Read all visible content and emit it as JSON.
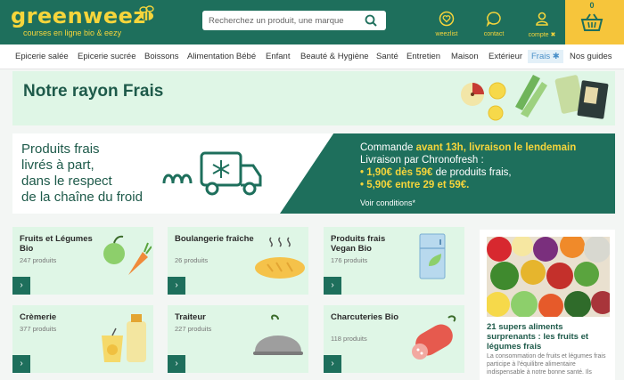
{
  "header": {
    "logo_text": "greenweez",
    "tagline": "courses en ligne bio & eezy",
    "search_placeholder": "Recherchez un produit, une marque",
    "weezlist_label": "weezlist",
    "contact_label": "contact",
    "account_label": "compte ✖",
    "cart_count": "0",
    "colors": {
      "brand_green": "#1e6f5c",
      "brand_yellow": "#f6d53b"
    }
  },
  "nav": {
    "items": [
      {
        "label": "Epicerie salée"
      },
      {
        "label": "Epicerie sucrée"
      },
      {
        "label": "Boissons"
      },
      {
        "label": "Alimentation Bébé"
      },
      {
        "label": "Enfant"
      },
      {
        "label": "Beauté & Hygiène"
      },
      {
        "label": "Santé"
      },
      {
        "label": "Entretien"
      },
      {
        "label": "Maison"
      },
      {
        "label": "Extérieur"
      },
      {
        "label": "Frais ✱"
      },
      {
        "label": "Nos guides"
      }
    ],
    "active": "Frais"
  },
  "banner": {
    "title": "Notre rayon Frais"
  },
  "delivery": {
    "left_line1": "Produits frais",
    "left_line2": "livrés à part,",
    "left_line3": "dans le respect",
    "left_line4": "de la chaîne du froid",
    "commande_prefix": "Commande ",
    "commande_highlight": "avant 13h, livraison le lendemain",
    "chronofresh": "Livraison par Chronofresh :",
    "price1_hl": "• 1,90€ dès 59€",
    "price1_rest": " de produits frais,",
    "price2_hl": "• 5,90€ entre 29 et 59€.",
    "conditions": "Voir conditions*"
  },
  "categories": [
    {
      "title": "Fruits et Légumes Bio",
      "count": "247 produits",
      "icon": "fruits-vegetables-icon"
    },
    {
      "title": "Boulangerie fraîche",
      "count": "26 produits",
      "icon": "bread-icon"
    },
    {
      "title": "Produits frais Vegan Bio",
      "count": "176 produits",
      "icon": "fridge-icon"
    },
    {
      "title": "Crèmerie",
      "count": "377 produits",
      "icon": "dairy-icon"
    },
    {
      "title": "Traiteur",
      "count": "227 produits",
      "icon": "cloche-icon"
    },
    {
      "title": "Charcuteries Bio",
      "count": "118 produits",
      "icon": "sausage-icon"
    }
  ],
  "category_arrow": "›",
  "article": {
    "title": "21 supers aliments surprenants : les fruits et légumes frais",
    "excerpt": "La consommation de fruits et légumes frais participe à l'équilibre alimentaire indispensable à notre bonne santé. Ils"
  }
}
